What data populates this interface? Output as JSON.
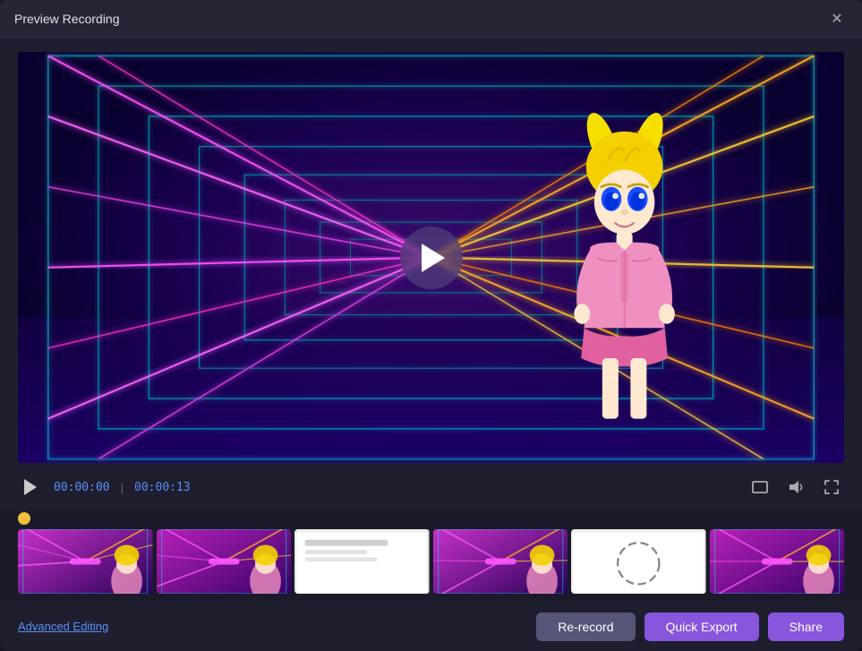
{
  "window": {
    "title": "Preview Recording",
    "close_icon": "×"
  },
  "video": {
    "play_icon": "▶"
  },
  "controls": {
    "time_current": "00:00:00",
    "time_separator": "|",
    "time_total": "00:00:13"
  },
  "thumbnails": [
    {
      "id": 1,
      "type": "neon-avatar",
      "color1": "#cc44cc",
      "color2": "#4422aa"
    },
    {
      "id": 2,
      "type": "neon-avatar",
      "color1": "#cc44cc",
      "color2": "#4422aa"
    },
    {
      "id": 3,
      "type": "white",
      "color1": "#e0e0e0",
      "color2": "#cccccc"
    },
    {
      "id": 4,
      "type": "neon-avatar",
      "color1": "#cc44cc",
      "color2": "#4422aa"
    },
    {
      "id": 5,
      "type": "white-drawing",
      "color1": "#f0f0f0",
      "color2": "#dddddd"
    },
    {
      "id": 6,
      "type": "neon-avatar",
      "color1": "#cc44cc",
      "color2": "#4422aa"
    }
  ],
  "bottom_bar": {
    "advanced_editing_label": "Advanced Editing",
    "rerecord_label": "Re-record",
    "export_label": "Quick Export",
    "share_label": "Share"
  },
  "icons": {
    "close": "✕",
    "play": "▶",
    "fullscreen": "⛶",
    "volume": "🔊",
    "expand": "⤢"
  }
}
